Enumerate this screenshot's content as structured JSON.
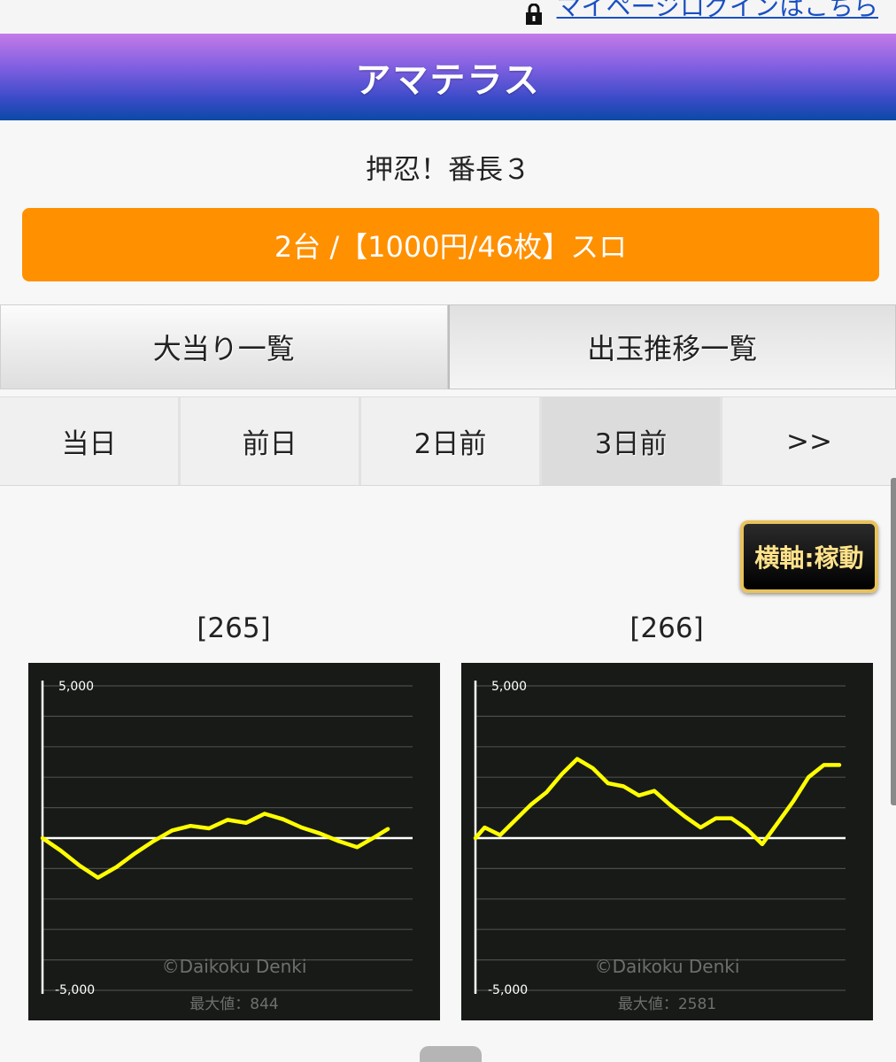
{
  "top_link": {
    "label": "マイページログインはこちら",
    "icon": "lock-icon"
  },
  "header": {
    "title": "アマテラス"
  },
  "machine": {
    "name": "押忍！番長３"
  },
  "summary": {
    "text": "2台 /【1000円/46枚】スロ"
  },
  "tabs": [
    {
      "label": "大当り一覧"
    },
    {
      "label": "出玉推移一覧"
    }
  ],
  "days": [
    {
      "label": "当日"
    },
    {
      "label": "前日"
    },
    {
      "label": "2日前"
    },
    {
      "label": "3日前"
    },
    {
      "label": ">>"
    }
  ],
  "axis_button": {
    "label": "横軸:稼動"
  },
  "units": [
    {
      "label": "[265]",
      "watermark": "©Daikoku Denki",
      "max_text": "最大値：844"
    },
    {
      "label": "[266]",
      "watermark": "©Daikoku Denki",
      "max_text": "最大値：2581"
    }
  ],
  "colors": {
    "accent_orange": "#ff9000",
    "line_yellow": "#ffff00",
    "chart_bg": "#171a17"
  },
  "chart_data": [
    {
      "type": "line",
      "title": "[265]",
      "ylim": [
        -5000,
        5000
      ],
      "yticks": [
        "5,000",
        "-5,000"
      ],
      "grid": true,
      "xlim": [
        0,
        12
      ],
      "series": [
        {
          "x": [
            0,
            0.6,
            1.2,
            1.8,
            2.4,
            3.0,
            3.6,
            4.2,
            4.8,
            5.4,
            6.0,
            6.6,
            7.2,
            7.8,
            8.4,
            9.0,
            9.6,
            10.2,
            10.8,
            11.2
          ],
          "y": [
            0,
            -420,
            -900,
            -1300,
            -950,
            -500,
            -100,
            250,
            400,
            320,
            600,
            500,
            800,
            620,
            350,
            150,
            -100,
            -300,
            50,
            300
          ]
        }
      ]
    },
    {
      "type": "line",
      "title": "[266]",
      "ylim": [
        -5000,
        5000
      ],
      "yticks": [
        "5,000",
        "-5,000"
      ],
      "grid": true,
      "xlim": [
        0,
        12
      ],
      "series": [
        {
          "x": [
            0,
            0.3,
            0.8,
            1.3,
            1.8,
            2.3,
            2.8,
            3.3,
            3.8,
            4.3,
            4.8,
            5.3,
            5.8,
            6.3,
            6.8,
            7.3,
            7.8,
            8.3,
            8.8,
            9.3,
            9.8,
            10.3,
            10.8,
            11.3,
            11.8
          ],
          "y": [
            0,
            350,
            100,
            600,
            1100,
            1500,
            2100,
            2600,
            2300,
            1800,
            1700,
            1400,
            1550,
            1100,
            700,
            350,
            650,
            650,
            300,
            -200,
            500,
            1200,
            2000,
            2400,
            2400
          ]
        }
      ]
    }
  ]
}
